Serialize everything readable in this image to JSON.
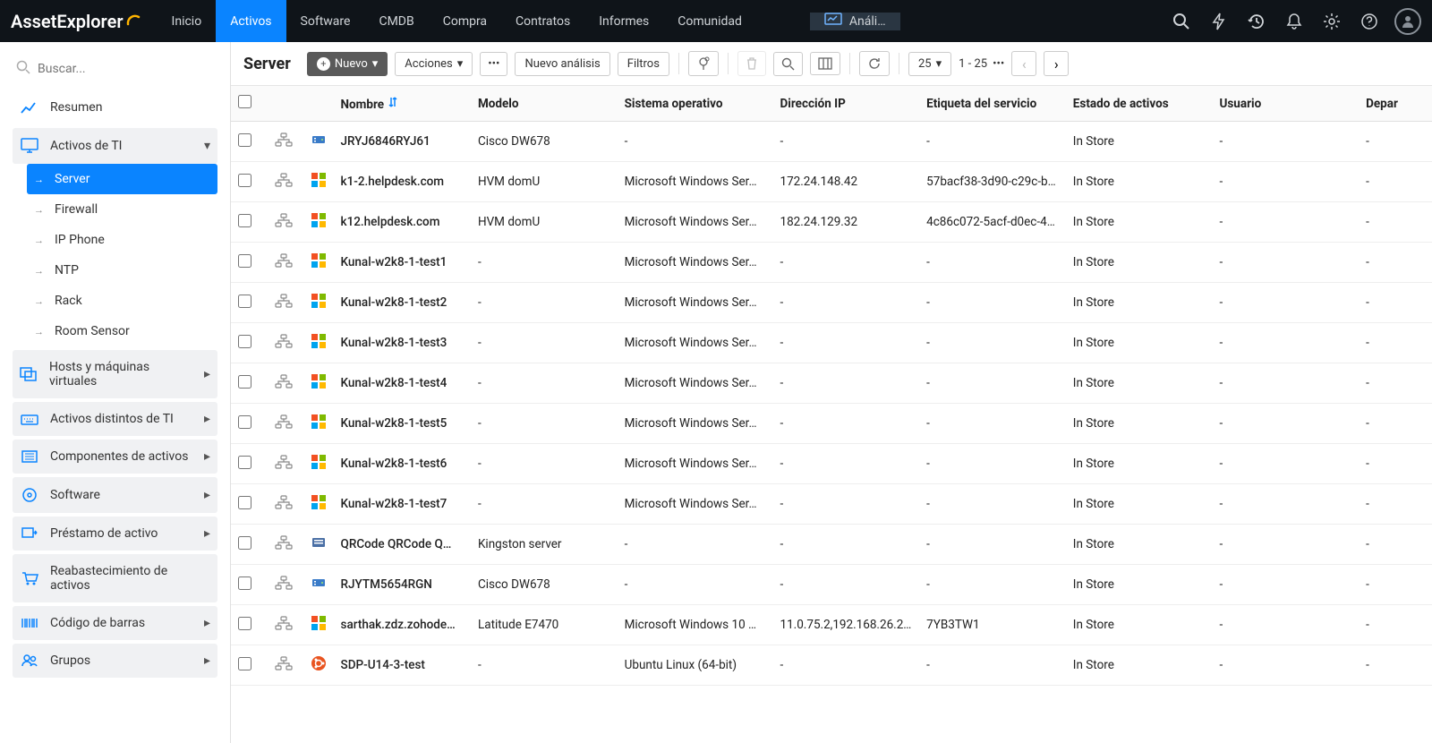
{
  "brand": "AssetExplorer",
  "nav": {
    "items": [
      "Inicio",
      "Activos",
      "Software",
      "CMDB",
      "Compra",
      "Contratos",
      "Informes",
      "Comunidad"
    ],
    "activeIndex": 1,
    "special": "Análi…"
  },
  "sidebar": {
    "searchPlaceholder": "Buscar...",
    "summary": "Resumen",
    "groups": {
      "it": {
        "label": "Activos de TI",
        "items": [
          "Server",
          "Firewall",
          "IP Phone",
          "NTP",
          "Rack",
          "Room Sensor"
        ],
        "activeIndex": 0
      },
      "hosts": "Hosts y máquinas virtuales",
      "nonit": "Activos distintos de TI",
      "components": "Componentes de activos",
      "software": "Software",
      "loan": "Préstamo de activo",
      "replenish": "Reabastecimiento de activos",
      "barcode": "Código de barras",
      "groupsLabel": "Grupos"
    }
  },
  "toolbar": {
    "title": "Server",
    "newBtn": "Nuevo",
    "actions": "Acciones",
    "newScan": "Nuevo análisis",
    "filters": "Filtros",
    "pageSize": "25",
    "range": "1 - 25"
  },
  "columns": [
    "Nombre",
    "Modelo",
    "Sistema operativo",
    "Dirección IP",
    "Etiqueta del servicio",
    "Estado de activos",
    "Usuario",
    "Depar"
  ],
  "rows": [
    {
      "icon": "cisco",
      "name": "JRYJ6846RYJ61",
      "model": "Cisco DW678",
      "os": "-",
      "ip": "-",
      "tag": "-",
      "state": "In Store",
      "user": "-",
      "dept": "-"
    },
    {
      "icon": "win",
      "name": "k1-2.helpdesk.com",
      "model": "HVM domU",
      "os": "Microsoft Windows Ser…",
      "ip": "172.24.148.42",
      "tag": "57bacf38-3d90-c29c-b…",
      "state": "In Store",
      "user": "-",
      "dept": "-"
    },
    {
      "icon": "win",
      "name": "k12.helpdesk.com",
      "model": "HVM domU",
      "os": "Microsoft Windows Ser…",
      "ip": "182.24.129.32",
      "tag": "4c86c072-5acf-d0ec-4…",
      "state": "In Store",
      "user": "-",
      "dept": "-"
    },
    {
      "icon": "win",
      "name": "Kunal-w2k8-1-test1",
      "model": "-",
      "os": "Microsoft Windows Ser…",
      "ip": "-",
      "tag": "-",
      "state": "In Store",
      "user": "-",
      "dept": "-"
    },
    {
      "icon": "win",
      "name": "Kunal-w2k8-1-test2",
      "model": "-",
      "os": "Microsoft Windows Ser…",
      "ip": "-",
      "tag": "-",
      "state": "In Store",
      "user": "-",
      "dept": "-"
    },
    {
      "icon": "win",
      "name": "Kunal-w2k8-1-test3",
      "model": "-",
      "os": "Microsoft Windows Ser…",
      "ip": "-",
      "tag": "-",
      "state": "In Store",
      "user": "-",
      "dept": "-"
    },
    {
      "icon": "win",
      "name": "Kunal-w2k8-1-test4",
      "model": "-",
      "os": "Microsoft Windows Ser…",
      "ip": "-",
      "tag": "-",
      "state": "In Store",
      "user": "-",
      "dept": "-"
    },
    {
      "icon": "win",
      "name": "Kunal-w2k8-1-test5",
      "model": "-",
      "os": "Microsoft Windows Ser…",
      "ip": "-",
      "tag": "-",
      "state": "In Store",
      "user": "-",
      "dept": "-"
    },
    {
      "icon": "win",
      "name": "Kunal-w2k8-1-test6",
      "model": "-",
      "os": "Microsoft Windows Ser…",
      "ip": "-",
      "tag": "-",
      "state": "In Store",
      "user": "-",
      "dept": "-"
    },
    {
      "icon": "win",
      "name": "Kunal-w2k8-1-test7",
      "model": "-",
      "os": "Microsoft Windows Ser…",
      "ip": "-",
      "tag": "-",
      "state": "In Store",
      "user": "-",
      "dept": "-"
    },
    {
      "icon": "server",
      "name": "QRCode QRCode Q…",
      "model": "Kingston server",
      "os": "-",
      "ip": "-",
      "tag": "-",
      "state": "In Store",
      "user": "-",
      "dept": "-"
    },
    {
      "icon": "cisco",
      "name": "RJYTM5654RGN",
      "model": "Cisco DW678",
      "os": "-",
      "ip": "-",
      "tag": "-",
      "state": "In Store",
      "user": "-",
      "dept": "-"
    },
    {
      "icon": "win",
      "name": "sarthak.zdz.zohode…",
      "model": "Latitude E7470",
      "os": "Microsoft Windows 10 …",
      "ip": "11.0.75.2,192.168.26.2…",
      "tag": "7YB3TW1",
      "state": "In Store",
      "user": "-",
      "dept": "-"
    },
    {
      "icon": "ubuntu",
      "name": "SDP-U14-3-test",
      "model": "-",
      "os": "Ubuntu Linux (64-bit)",
      "ip": "-",
      "tag": "-",
      "state": "In Store",
      "user": "-",
      "dept": "-"
    }
  ]
}
